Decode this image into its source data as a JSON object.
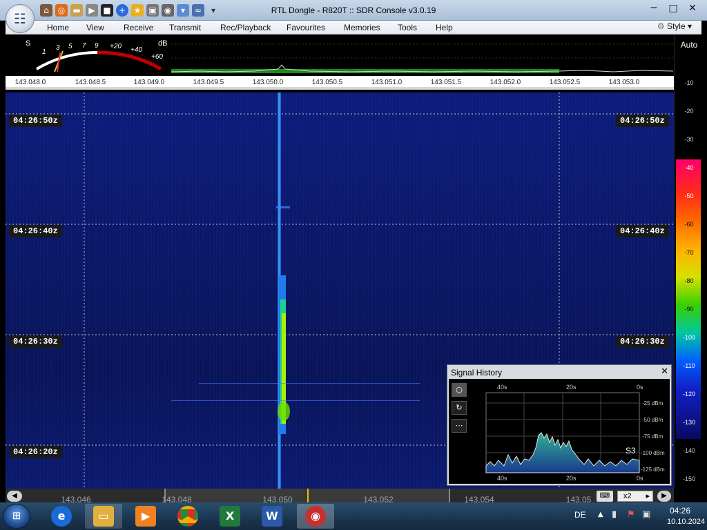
{
  "window": {
    "title": "RTL Dongle - R820T :: SDR Console v3.0.19"
  },
  "quick_access": [
    "home-icon",
    "lifebuoy-icon",
    "folder-icon",
    "play-icon",
    "record-icon",
    "plus-icon",
    "star-icon",
    "lock-icon",
    "camera-icon",
    "droplet-icon",
    "radio-icon",
    "dropdown-icon"
  ],
  "window_controls": {
    "minimize": "─",
    "maximize": "□",
    "close": "✕"
  },
  "menu": {
    "items": [
      "Home",
      "View",
      "Receive",
      "Transmit",
      "Rec/Playback",
      "Favourites",
      "Memories",
      "Tools",
      "Help"
    ],
    "style_label": "Style"
  },
  "meter": {
    "s_label": "S",
    "db_label": "dB",
    "scale": [
      "1",
      "3",
      "5",
      "7",
      "9",
      "+20",
      "+40",
      "+60"
    ]
  },
  "freq_top": [
    "143.048.0",
    "143.048.5",
    "143.049.0",
    "143.049.5",
    "143.050.0",
    "143.050.5",
    "143.051.0",
    "143.051.5",
    "143.052.0",
    "143.052.5",
    "143.053.0"
  ],
  "waterfall": {
    "timestamps": [
      "04:26:50z",
      "04:26:40z",
      "04:26:30z",
      "04:26:20z"
    ]
  },
  "right_scale": {
    "mode": "Auto",
    "db_values": [
      "-10",
      "-20",
      "-30",
      "-40",
      "-50",
      "-60",
      "-70",
      "-80",
      "-90",
      "-100",
      "-110",
      "-120",
      "-130",
      "-140",
      "-150"
    ]
  },
  "signal_history": {
    "title": "Signal History",
    "close": "✕",
    "buttons": [
      "○",
      "↻",
      "⋯"
    ],
    "x_top": [
      "40s",
      "20s",
      "0s"
    ],
    "x_bottom": [
      "40s",
      "20s",
      "0s"
    ],
    "y_labels": [
      "-25 dBm",
      "-50 dBm",
      "-75 dBm",
      "-100 dBm",
      "-125 dBm"
    ],
    "s_reading": "S3"
  },
  "bottom_freq": {
    "labels": [
      "143.046",
      "143.048",
      "143.050",
      "143.052",
      "143.054",
      "143.05"
    ],
    "zoom": "x2"
  },
  "taskbar": {
    "apps": [
      "explorer-icon",
      "internet-explorer-icon",
      "file-explorer-icon",
      "media-player-icon",
      "chrome-icon",
      "excel-icon",
      "word-icon",
      "sdr-console-icon"
    ],
    "lang": "DE",
    "time": "04:26",
    "date": "10.10.2024"
  }
}
